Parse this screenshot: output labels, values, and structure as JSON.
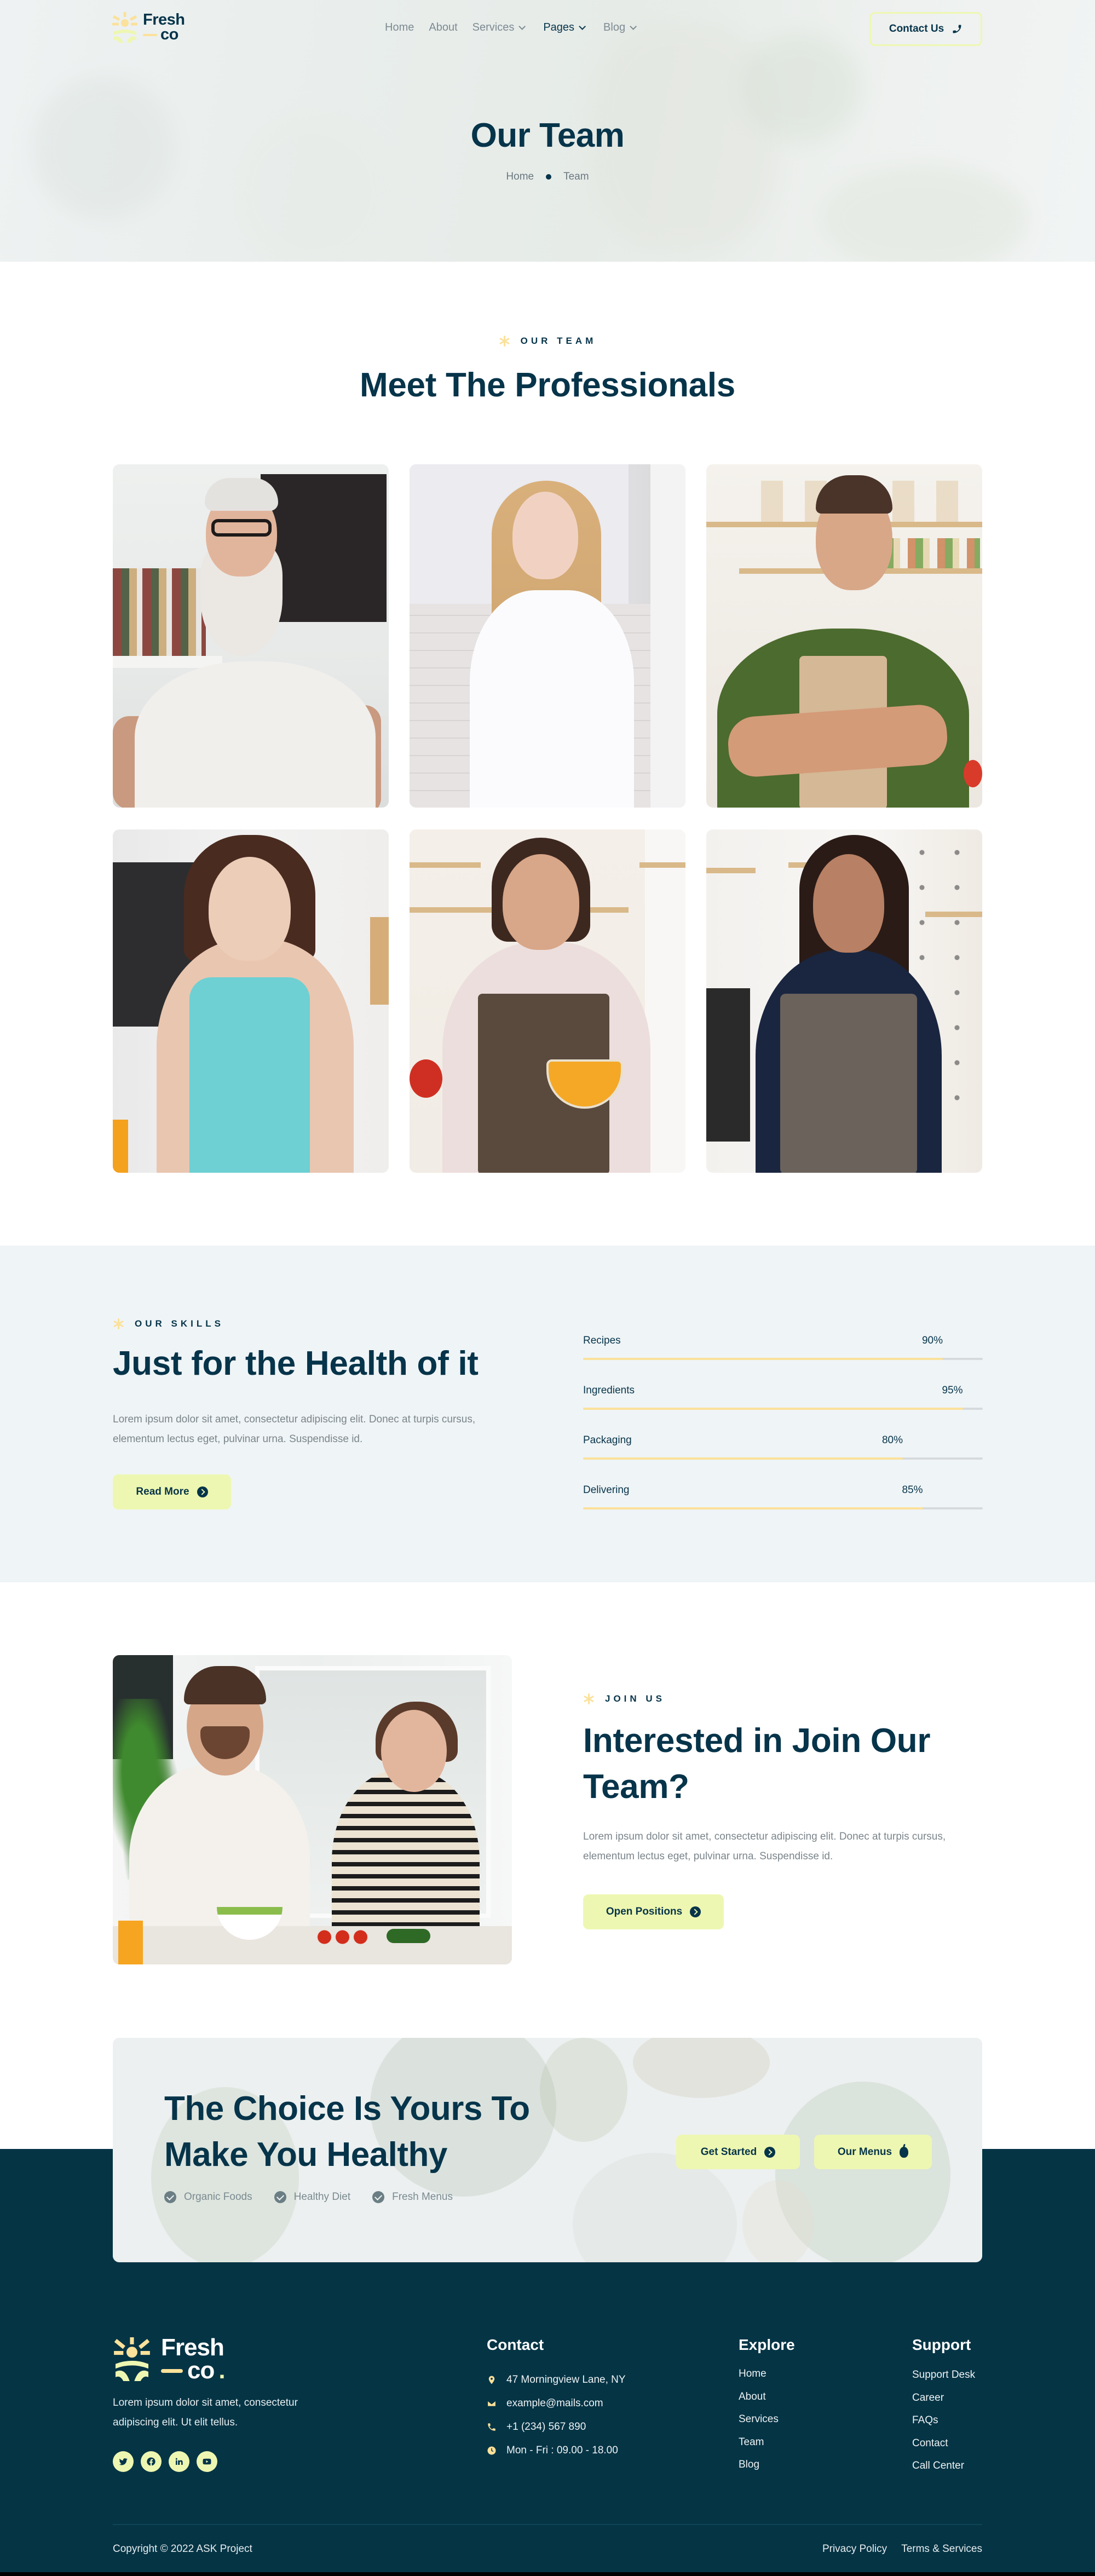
{
  "brand": {
    "name_line1": "Fresh",
    "name_line2": "co",
    "name_dot": ".",
    "colors": {
      "primary": "#06344a",
      "accent_lime": "#eef7b1",
      "accent_yellow": "#fbe19a",
      "muted_text": "#7b858b",
      "section_bg": "#eff4f6"
    }
  },
  "nav": {
    "items": [
      {
        "label": "Home",
        "has_dropdown": false,
        "active": false
      },
      {
        "label": "About",
        "has_dropdown": false,
        "active": false
      },
      {
        "label": "Services",
        "has_dropdown": true,
        "active": false
      },
      {
        "label": "Pages",
        "has_dropdown": true,
        "active": true
      },
      {
        "label": "Blog",
        "has_dropdown": true,
        "active": false
      }
    ],
    "contact_button": {
      "label": "Contact Us",
      "icon": "phone-icon"
    }
  },
  "hero": {
    "title": "Our Team",
    "breadcrumb": [
      "Home",
      "Team"
    ]
  },
  "team": {
    "eyebrow": "OUR TEAM",
    "title": "Meet The Professionals",
    "members": [
      {
        "photo": "Older bearded man with glasses in white t-shirt in kitchen"
      },
      {
        "photo": "Young blonde woman in white shirt in kitchen"
      },
      {
        "photo": "Smiling man in green shirt and beige apron, arms crossed"
      },
      {
        "photo": "Smiling woman with bob haircut in turquoise tank top"
      },
      {
        "photo": "Smiling woman in apron whisking eggs in glass bowl"
      },
      {
        "photo": "Smiling woman in navy top and grey apron"
      }
    ]
  },
  "skills": {
    "eyebrow": "OUR SKILLS",
    "title": "Just for the Health of it",
    "text": "Lorem ipsum dolor sit amet, consectetur adipiscing elit. Donec at turpis cursus, elementum lectus eget, pulvinar urna. Suspendisse id.",
    "button": "Read More",
    "bars": [
      {
        "label": "Recipes",
        "value": 90,
        "display": "90%"
      },
      {
        "label": "Ingredients",
        "value": 95,
        "display": "95%"
      },
      {
        "label": "Packaging",
        "value": 80,
        "display": "80%"
      },
      {
        "label": "Delivering",
        "value": 85,
        "display": "85%"
      }
    ]
  },
  "join": {
    "eyebrow": "JOIN US",
    "title": "Interested in Join Our Team?",
    "text": "Lorem ipsum dolor sit amet, consectetur adipiscing elit. Donec at turpis cursus, elementum lectus eget, pulvinar urna. Suspendisse id.",
    "button": "Open Positions",
    "photo": "Couple laughing while preparing salad in bright kitchen"
  },
  "cta": {
    "title": "The Choice Is Yours To Make You Healthy",
    "features": [
      "Organic Foods",
      "Healthy Diet",
      "Fresh Menus"
    ],
    "buttons": {
      "primary": "Get Started",
      "secondary": "Our Menus"
    }
  },
  "footer": {
    "description": "Lorem ipsum dolor sit amet, consectetur adipiscing elit. Ut elit tellus.",
    "socials": [
      "twitter-icon",
      "facebook-icon",
      "linkedin-icon",
      "youtube-icon"
    ],
    "contact": {
      "title": "Contact",
      "address": "47 Morningview Lane, NY",
      "email": "example@mails.com",
      "phone": "+1 (234) 567 890",
      "hours": "Mon - Fri : 09.00 - 18.00"
    },
    "explore": {
      "title": "Explore",
      "links": [
        "Home",
        "About",
        "Services",
        "Team",
        "Blog"
      ]
    },
    "support": {
      "title": "Support",
      "links": [
        "Support Desk",
        "Career",
        "FAQs",
        "Contact",
        "Call Center"
      ]
    },
    "copyright": "Copyright © 2022 ASK Project",
    "legal": [
      "Privacy Policy",
      "Terms & Services"
    ]
  }
}
